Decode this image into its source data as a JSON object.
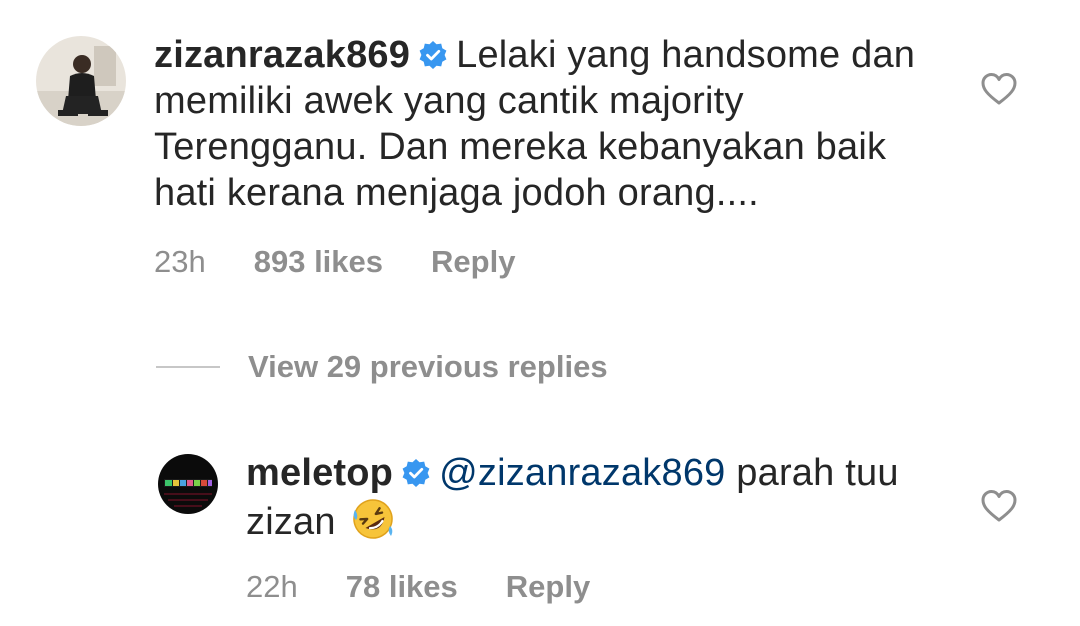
{
  "comments": [
    {
      "username": "zizanrazak869",
      "verified": true,
      "text": "Lelaki yang handsome dan memiliki awek yang cantik majority Terengganu. Dan mereka kebanyakan baik hati kerana menjaga jodoh orang....",
      "time": "23h",
      "likes": "893 likes",
      "reply_label": "Reply",
      "avatar_icon": "user-photo-avatar"
    }
  ],
  "view_replies_label": "View 29 previous replies",
  "replies": [
    {
      "username": "meletop",
      "verified": true,
      "mention": "@zizanrazak869",
      "text": "parah tuu zizan",
      "emoji": "rolling-on-floor-laughing-emoji",
      "time": "22h",
      "likes": "78 likes",
      "reply_label": "Reply",
      "avatar_icon": "meletop-logo-avatar"
    }
  ],
  "colors": {
    "text": "#262626",
    "secondary": "#8e8e8e",
    "mention": "#00376b",
    "verified": "#3897f0"
  }
}
